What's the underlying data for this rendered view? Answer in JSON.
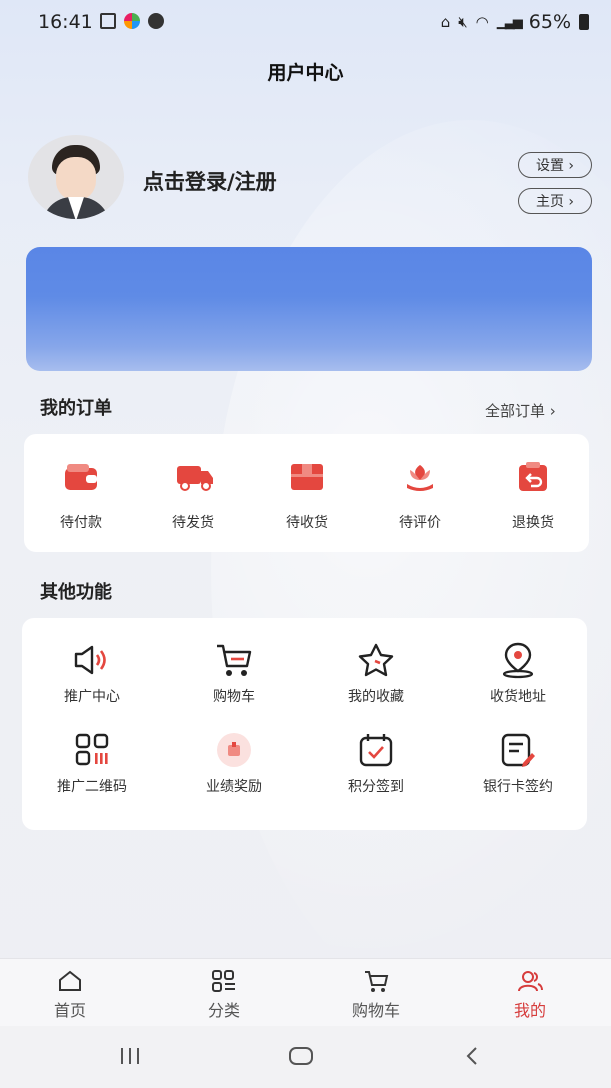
{
  "status_bar": {
    "time": "16:41",
    "battery": "65%"
  },
  "header": {
    "title": "用户中心"
  },
  "profile": {
    "login_text": "点击登录/注册",
    "settings_label": "设置 ›",
    "home_label": "主页 ›"
  },
  "orders": {
    "title": "我的订单",
    "all_label": "全部订单 ›",
    "items": [
      {
        "label": "待付款",
        "icon": "wallet-icon"
      },
      {
        "label": "待发货",
        "icon": "truck-icon"
      },
      {
        "label": "待收货",
        "icon": "box-icon"
      },
      {
        "label": "待评价",
        "icon": "flower-icon"
      },
      {
        "label": "退换货",
        "icon": "return-icon"
      }
    ]
  },
  "functions": {
    "title": "其他功能",
    "items": [
      {
        "label": "推广中心",
        "icon": "speaker-icon"
      },
      {
        "label": "购物车",
        "icon": "cart-icon"
      },
      {
        "label": "我的收藏",
        "icon": "star-icon"
      },
      {
        "label": "收货地址",
        "icon": "location-icon"
      },
      {
        "label": "推广二维码",
        "icon": "qrcode-icon"
      },
      {
        "label": "业绩奖励",
        "icon": "reward-icon"
      },
      {
        "label": "积分签到",
        "icon": "calendar-check-icon"
      },
      {
        "label": "银行卡签约",
        "icon": "sign-doc-icon"
      }
    ]
  },
  "tabbar": {
    "items": [
      {
        "label": "首页",
        "icon": "home-icon"
      },
      {
        "label": "分类",
        "icon": "category-icon"
      },
      {
        "label": "购物车",
        "icon": "cart-icon"
      },
      {
        "label": "我的",
        "icon": "user-icon"
      }
    ],
    "active_color": "#d63c3c"
  },
  "colors": {
    "accent_red": "#e4473f",
    "banner_blue": "#5a86e6"
  }
}
